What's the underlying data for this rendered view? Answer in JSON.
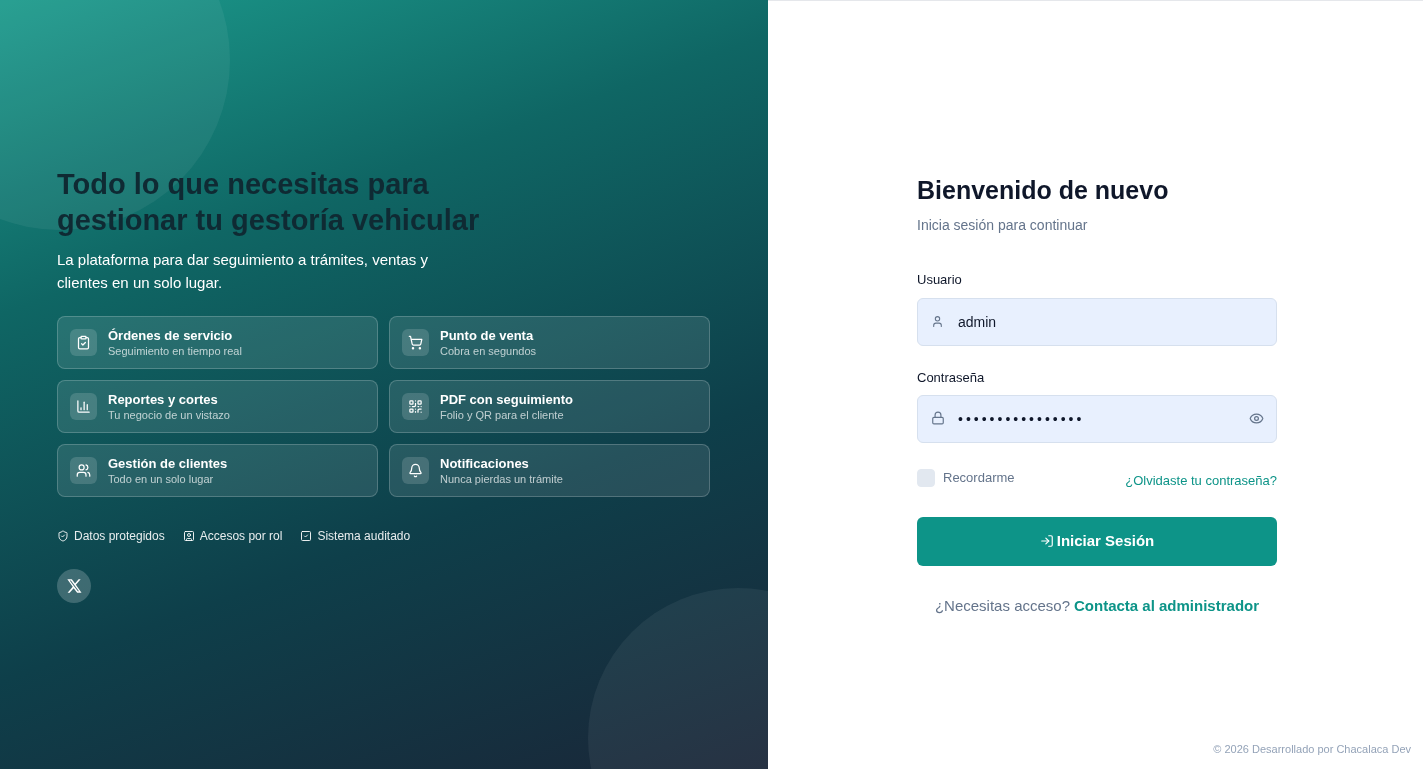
{
  "hero": {
    "title_lines": [
      "Todo lo que necesitas para",
      "gestionar tu gestoría vehicular"
    ],
    "subtitle": "La plataforma para dar seguimiento a trámites, ventas y clientes en un solo lugar.",
    "features": [
      {
        "title": "Órdenes de servicio",
        "subtitle": "Seguimiento en tiempo real"
      },
      {
        "title": "Punto de venta",
        "subtitle": "Cobra en segundos"
      },
      {
        "title": "Reportes y cortes",
        "subtitle": "Tu negocio de un vistazo"
      },
      {
        "title": "PDF con seguimiento",
        "subtitle": "Folio y QR para el cliente"
      },
      {
        "title": "Gestión de clientes",
        "subtitle": "Todo en un solo lugar"
      },
      {
        "title": "Notificaciones",
        "subtitle": "Nunca pierdas un trámite"
      }
    ],
    "badges": [
      "Datos protegidos",
      "Accesos por rol",
      "Sistema auditado"
    ]
  },
  "login": {
    "title": "Bienvenido de nuevo",
    "subtitle": "Inicia sesión para continuar",
    "username": {
      "label": "Usuario",
      "value": "admin"
    },
    "password": {
      "label": "Contraseña",
      "value": "••••••••••••••••"
    },
    "remember": {
      "label": "Recordarme",
      "checked": false
    },
    "forgot": "¿Olvidaste tu contraseña?",
    "submit": "Iniciar Sesión",
    "access_prompt": "¿Necesitas acceso?",
    "access_link": "Contacta al administrador"
  },
  "footer": "© 2026 Desarrollado por Chacalaca Dev"
}
